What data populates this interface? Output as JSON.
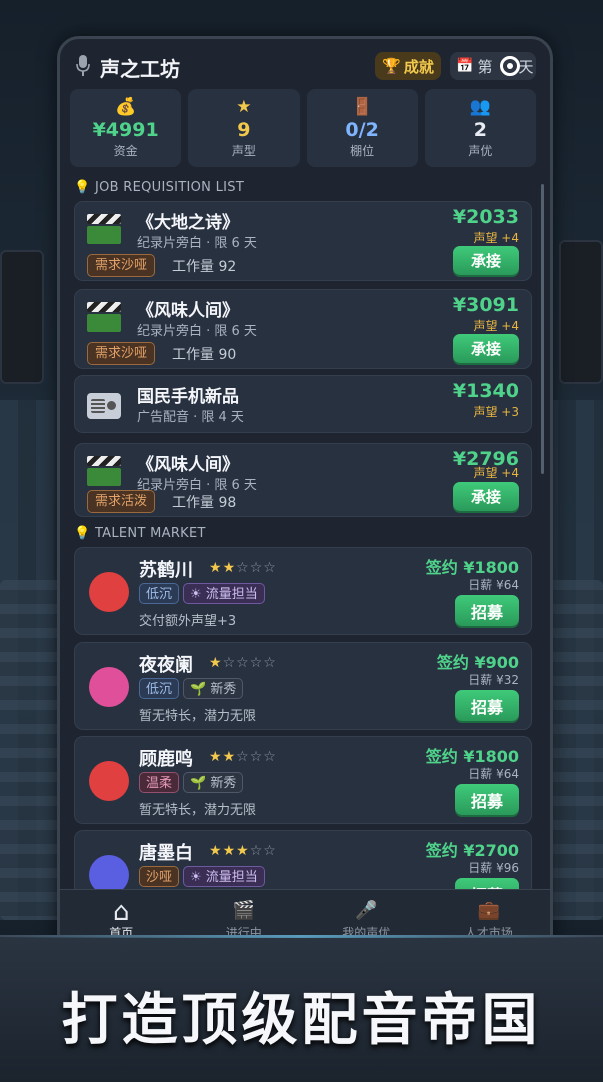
{
  "app": {
    "title": "声之工坊",
    "achievement_label": "成就",
    "day_label": "第",
    "day_suffix": "天"
  },
  "stats": [
    {
      "icon": "money-bag-icon",
      "value": "¥4991",
      "label": "资金",
      "color": "#4fd38a"
    },
    {
      "icon": "star-icon",
      "value": "9",
      "label": "声型",
      "color": "#f2c94c"
    },
    {
      "icon": "booth-icon",
      "value": "0/2",
      "label": "棚位",
      "color": "#7fb5ff"
    },
    {
      "icon": "people-icon",
      "value": "2",
      "label": "声优",
      "color": "#e8ecf3"
    }
  ],
  "jobs_section": {
    "title": "JOB REQUISITION LIST"
  },
  "jobs": [
    {
      "icon": "clapperboard-icon",
      "title": "《大地之诗》",
      "subtitle": "纪录片旁白 · 限 6 天",
      "requirement": "需求沙哑",
      "workload": "工作量 92",
      "price": "¥2033",
      "fame": "声望 +4",
      "action": "承接"
    },
    {
      "icon": "clapperboard-icon",
      "title": "《风味人间》",
      "subtitle": "纪录片旁白 · 限 6 天",
      "requirement": "需求沙哑",
      "workload": "工作量 90",
      "price": "¥3091",
      "fame": "声望 +4",
      "action": "承接"
    },
    {
      "icon": "radio-icon",
      "title": "国民手机新品",
      "subtitle": "广告配音 · 限 4 天",
      "price": "¥1340",
      "fame": "声望 +3"
    },
    {
      "icon": "clapperboard-icon",
      "title": "《风味人间》",
      "subtitle": "纪录片旁白 · 限 6 天",
      "requirement": "需求活泼",
      "workload": "工作量 98",
      "price": "¥2796",
      "fame": "声望 +4",
      "action": "承接"
    }
  ],
  "talent_section": {
    "title": "TALENT MARKET"
  },
  "talents": [
    {
      "name": "苏鹤川",
      "stars": 2,
      "avatar_color": "#e04040",
      "tags": [
        {
          "text": "低沉",
          "style": "blue"
        },
        {
          "text": "☀ 流量担当",
          "style": "purple"
        }
      ],
      "desc": "交付额外声望+3",
      "sign": "签约 ¥1800",
      "salary": "日薪 ¥64",
      "action": "招募"
    },
    {
      "name": "夜夜阑",
      "stars": 1,
      "avatar_color": "#e0509a",
      "tags": [
        {
          "text": "低沉",
          "style": "blue"
        },
        {
          "text": "🌱 新秀",
          "style": "gray"
        }
      ],
      "desc": "暂无特长，潜力无限",
      "sign": "签约 ¥900",
      "salary": "日薪 ¥32",
      "action": "招募"
    },
    {
      "name": "顾鹿鸣",
      "stars": 2,
      "avatar_color": "#e04040",
      "tags": [
        {
          "text": "温柔",
          "style": "pink"
        },
        {
          "text": "🌱 新秀",
          "style": "gray"
        }
      ],
      "desc": "暂无特长，潜力无限",
      "sign": "签约 ¥1800",
      "salary": "日薪 ¥64",
      "action": "招募"
    },
    {
      "name": "唐墨白",
      "stars": 3,
      "avatar_color": "#5a5ee0",
      "tags": [
        {
          "text": "沙哑",
          "style": "orange"
        },
        {
          "text": "☀ 流量担当",
          "style": "purple"
        }
      ],
      "desc": "",
      "sign": "签约 ¥2700",
      "salary": "日薪 ¥96",
      "action": "招募"
    }
  ],
  "tabs": [
    {
      "icon": "home-icon",
      "label": "首页",
      "active": true
    },
    {
      "icon": "clapperboard-icon",
      "label": "进行中",
      "active": false
    },
    {
      "icon": "microphone-icon",
      "label": "我的声优",
      "active": false
    },
    {
      "icon": "briefcase-icon",
      "label": "人才市场",
      "active": false
    }
  ],
  "banner": {
    "slogan": "打造顶级配音帝国"
  }
}
